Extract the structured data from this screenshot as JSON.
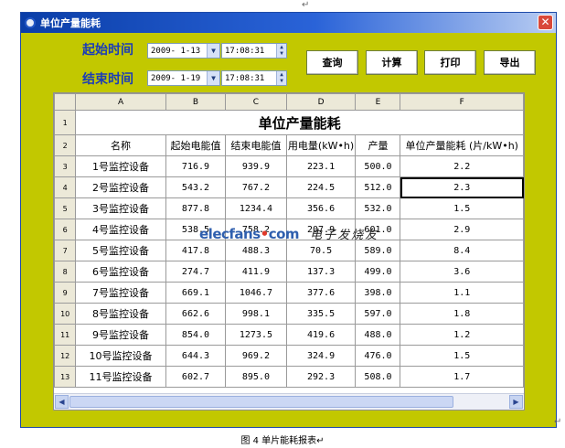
{
  "marks": {
    "top": "↵",
    "bottom_right": "↵"
  },
  "window": {
    "title": "单位产量能耗",
    "close": "✕"
  },
  "form": {
    "start_label": "起始时间",
    "end_label": "结束时间",
    "start_date": "2009- 1-13",
    "start_time": "17:08:31",
    "end_date": "2009- 1-19",
    "end_time": "17:08:31"
  },
  "buttons": {
    "query": "查询",
    "calc": "计算",
    "print": "打印",
    "export": "导出"
  },
  "grid": {
    "col_headers": [
      "A",
      "B",
      "C",
      "D",
      "E",
      "F"
    ],
    "row_numbers": [
      "1",
      "2",
      "3",
      "4",
      "5",
      "6",
      "7",
      "8",
      "9",
      "10",
      "11",
      "12",
      "13"
    ],
    "sheet_title": "单位产量能耗",
    "header_row": [
      "名称",
      "起始电能值",
      "结束电能值",
      "用电量(kW•h)",
      "产量",
      "单位产量能耗 (片/kW•h)"
    ],
    "rows": [
      [
        "1号监控设备",
        "716.9",
        "939.9",
        "223.1",
        "500.0",
        "2.2"
      ],
      [
        "2号监控设备",
        "543.2",
        "767.2",
        "224.5",
        "512.0",
        "2.3"
      ],
      [
        "3号监控设备",
        "877.8",
        "1234.4",
        "356.6",
        "532.0",
        "1.5"
      ],
      [
        "4号监控设备",
        "538.5",
        "758.2",
        "207.9",
        "601.0",
        "2.9"
      ],
      [
        "5号监控设备",
        "417.8",
        "488.3",
        "70.5",
        "589.0",
        "8.4"
      ],
      [
        "6号监控设备",
        "274.7",
        "411.9",
        "137.3",
        "499.0",
        "3.6"
      ],
      [
        "7号监控设备",
        "669.1",
        "1046.7",
        "377.6",
        "398.0",
        "1.1"
      ],
      [
        "8号监控设备",
        "662.6",
        "998.1",
        "335.5",
        "597.0",
        "1.8"
      ],
      [
        "9号监控设备",
        "854.0",
        "1273.5",
        "419.6",
        "488.0",
        "1.2"
      ],
      [
        "10号监控设备",
        "644.3",
        "969.2",
        "324.9",
        "476.0",
        "1.5"
      ],
      [
        "11号监控设备",
        "602.7",
        "895.0",
        "292.3",
        "508.0",
        "1.7"
      ]
    ],
    "selected_row": 1
  },
  "watermark": {
    "brand_a": "elecfans",
    "brand_dot": "•",
    "brand_b": "com",
    "sub": "电子发烧友"
  },
  "caption": "图 4  单片能耗报表↵",
  "colors": {
    "window_bg": "#c2c800",
    "label_blue": "#1a3cb8",
    "titlebar": "#0a3ea8"
  }
}
